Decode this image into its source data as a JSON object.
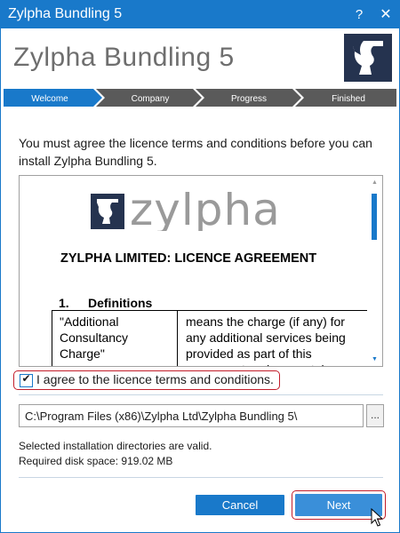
{
  "window": {
    "title": "Zylpha Bundling 5",
    "help_glyph": "?",
    "close_glyph": "✕"
  },
  "header": {
    "app_title": "Zylpha Bundling 5",
    "logo_icon": "zylpha-head-logo"
  },
  "steps": [
    {
      "label": "Welcome",
      "active": true
    },
    {
      "label": "Company",
      "active": false
    },
    {
      "label": "Progress",
      "active": false
    },
    {
      "label": "Finished",
      "active": false
    }
  ],
  "intro": {
    "text": "You must agree the licence terms and conditions before you can install Zylpha Bundling 5."
  },
  "licence": {
    "logo_text": "zylpha",
    "heading": "ZYLPHA LIMITED: LICENCE AGREEMENT",
    "section_number": "1.",
    "section_title": "Definitions",
    "term": "\"Additional Consultancy Charge\"",
    "meaning": "means the charge (if any) for any additional services being provided as part of this agreement and separately"
  },
  "agree": {
    "label": "I agree to the licence terms and conditions.",
    "checked": true
  },
  "install_path": {
    "value": "C:\\Program Files (x86)\\Zylpha Ltd\\Zylpha Bundling 5\\",
    "browse_label": "..."
  },
  "status": {
    "dirs_valid": "Selected installation directories are valid.",
    "disk_space": "Required disk space: 919.02 MB"
  },
  "buttons": {
    "cancel": "Cancel",
    "next": "Next"
  },
  "colors": {
    "accent": "#1979ca",
    "step_active": "#1979ca",
    "step_inactive": "#5a5a5a",
    "highlight": "#c21d2a",
    "logo_bg": "#25334f"
  }
}
